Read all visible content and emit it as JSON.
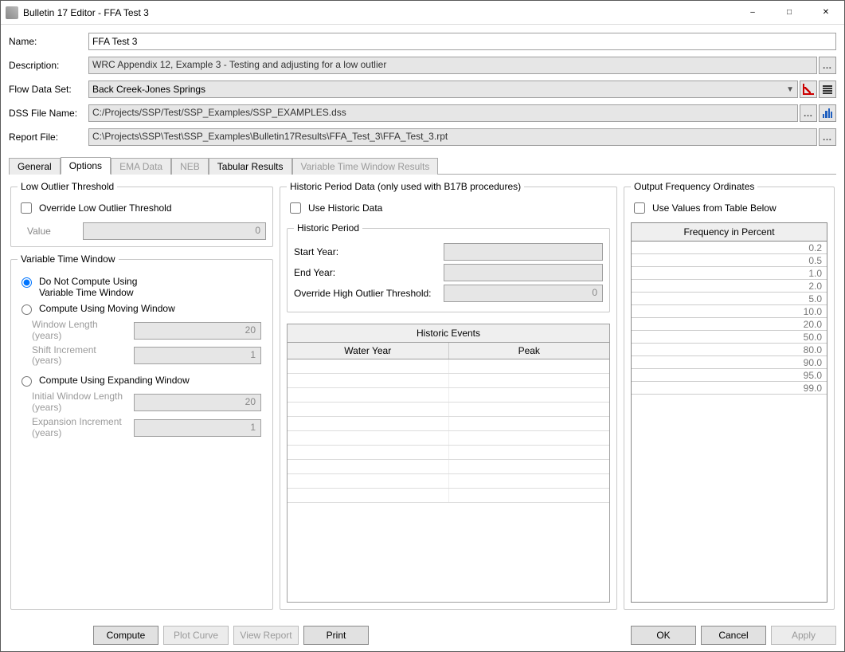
{
  "window": {
    "title": "Bulletin 17 Editor - FFA Test 3"
  },
  "header": {
    "name_label": "Name:",
    "name_value": "FFA Test 3",
    "description_label": "Description:",
    "description_value": "WRC Appendix 12, Example 3 - Testing and adjusting for a low outlier",
    "flow_data_set_label": "Flow Data Set:",
    "flow_data_set_value": "Back Creek-Jones Springs",
    "dss_file_label": "DSS File Name:",
    "dss_file_value": "C:/Projects/SSP/Test/SSP_Examples/SSP_EXAMPLES.dss",
    "report_file_label": "Report File:",
    "report_file_value": "C:\\Projects\\SSP\\Test\\SSP_Examples\\Bulletin17Results\\FFA_Test_3\\FFA_Test_3.rpt"
  },
  "tabs": {
    "general": "General",
    "options": "Options",
    "ema": "EMA Data",
    "neb": "NEB",
    "tabular": "Tabular Results",
    "vtw": "Variable Time Window Results"
  },
  "lowOutlier": {
    "legend": "Low Outlier Threshold",
    "override_label": "Override Low Outlier Threshold",
    "value_label": "Value",
    "value": "0"
  },
  "vtw": {
    "legend": "Variable Time Window",
    "opt_none": "Do Not Compute Using\nVariable Time Window",
    "opt_moving": "Compute Using Moving Window",
    "window_length_label": "Window Length\n(years)",
    "window_length_value": "20",
    "shift_inc_label": "Shift Increment\n(years)",
    "shift_inc_value": "1",
    "opt_expanding": "Compute Using Expanding Window",
    "init_len_label": "Initial Window Length\n(years)",
    "init_len_value": "20",
    "exp_inc_label": "Expansion Increment\n(years)",
    "exp_inc_value": "1"
  },
  "historic": {
    "legend": "Historic Period Data (only used with B17B procedures)",
    "use_label": "Use Historic Data",
    "period_legend": "Historic Period",
    "start_label": "Start Year:",
    "end_label": "End Year:",
    "override_label": "Override High Outlier Threshold:",
    "override_value": "0",
    "events_title": "Historic Events",
    "col_water_year": "Water Year",
    "col_peak": "Peak",
    "rows": [
      "",
      "",
      "",
      "",
      "",
      "",
      "",
      "",
      "",
      ""
    ]
  },
  "freq": {
    "legend": "Output Frequency Ordinates",
    "use_label": "Use Values from Table Below",
    "head": "Frequency in Percent",
    "values": [
      "0.2",
      "0.5",
      "1.0",
      "2.0",
      "5.0",
      "10.0",
      "20.0",
      "50.0",
      "80.0",
      "90.0",
      "95.0",
      "99.0"
    ]
  },
  "footer": {
    "compute": "Compute",
    "plot": "Plot Curve",
    "view": "View Report",
    "print": "Print",
    "ok": "OK",
    "cancel": "Cancel",
    "apply": "Apply"
  }
}
